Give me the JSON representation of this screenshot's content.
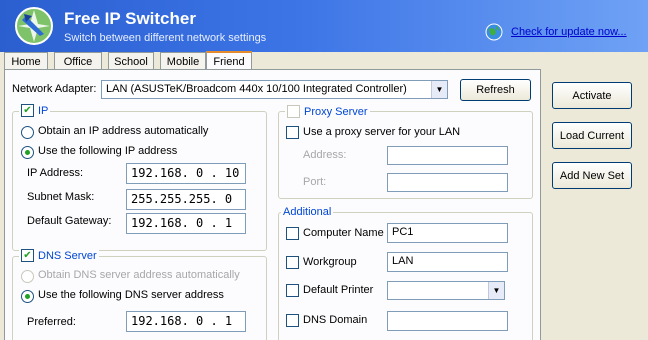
{
  "app": {
    "title": "Free IP Switcher",
    "subtitle": "Switch between different network settings",
    "update_link": "Check for update now..."
  },
  "tabs": [
    "Home",
    "Office",
    "School",
    "Mobile",
    "Friend"
  ],
  "active_tab": "Friend",
  "adapter": {
    "label": "Network Adapter:",
    "value": "LAN  (ASUSTeK/Broadcom 440x 10/100 Integrated Controller)",
    "refresh_label": "Refresh"
  },
  "ip": {
    "group_label": "IP",
    "auto_label": "Obtain an IP address automatically",
    "manual_label": "Use the following IP address",
    "address_label": "IP Address:",
    "address_value": "192.168.  0  . 10",
    "mask_label": "Subnet Mask:",
    "mask_value": "255.255.255.  0",
    "gateway_label": "Default Gateway:",
    "gateway_value": "192.168.  0  . 1"
  },
  "dns": {
    "group_label": "DNS Server",
    "auto_label": "Obtain DNS server address automatically",
    "manual_label": "Use the following DNS server address",
    "preferred_label": "Preferred:",
    "preferred_value": "192.168.  0  . 1"
  },
  "proxy": {
    "group_label": "Proxy Server",
    "use_label": "Use a proxy server for your LAN",
    "address_label": "Address:",
    "port_label": "Port:"
  },
  "additional": {
    "group_label": "Additional",
    "computer_name_label": "Computer Name",
    "computer_name_value": "PC1",
    "workgroup_label": "Workgroup",
    "workgroup_value": "LAN",
    "printer_label": "Default Printer",
    "dns_domain_label": "DNS Domain"
  },
  "buttons": {
    "activate": "Activate",
    "load_current": "Load Current",
    "add_new_set": "Add New Set"
  },
  "colors": {
    "header_start": "#2b5fd0",
    "header_end": "#6fa2f5",
    "tab_highlight": "#e68b2c",
    "group_title": "#0046d5",
    "check_mark": "#21a121"
  },
  "icons": [
    "network-switch-logo-icon",
    "globe-update-icon",
    "chevron-down-icon",
    "checkmark-icon"
  ]
}
